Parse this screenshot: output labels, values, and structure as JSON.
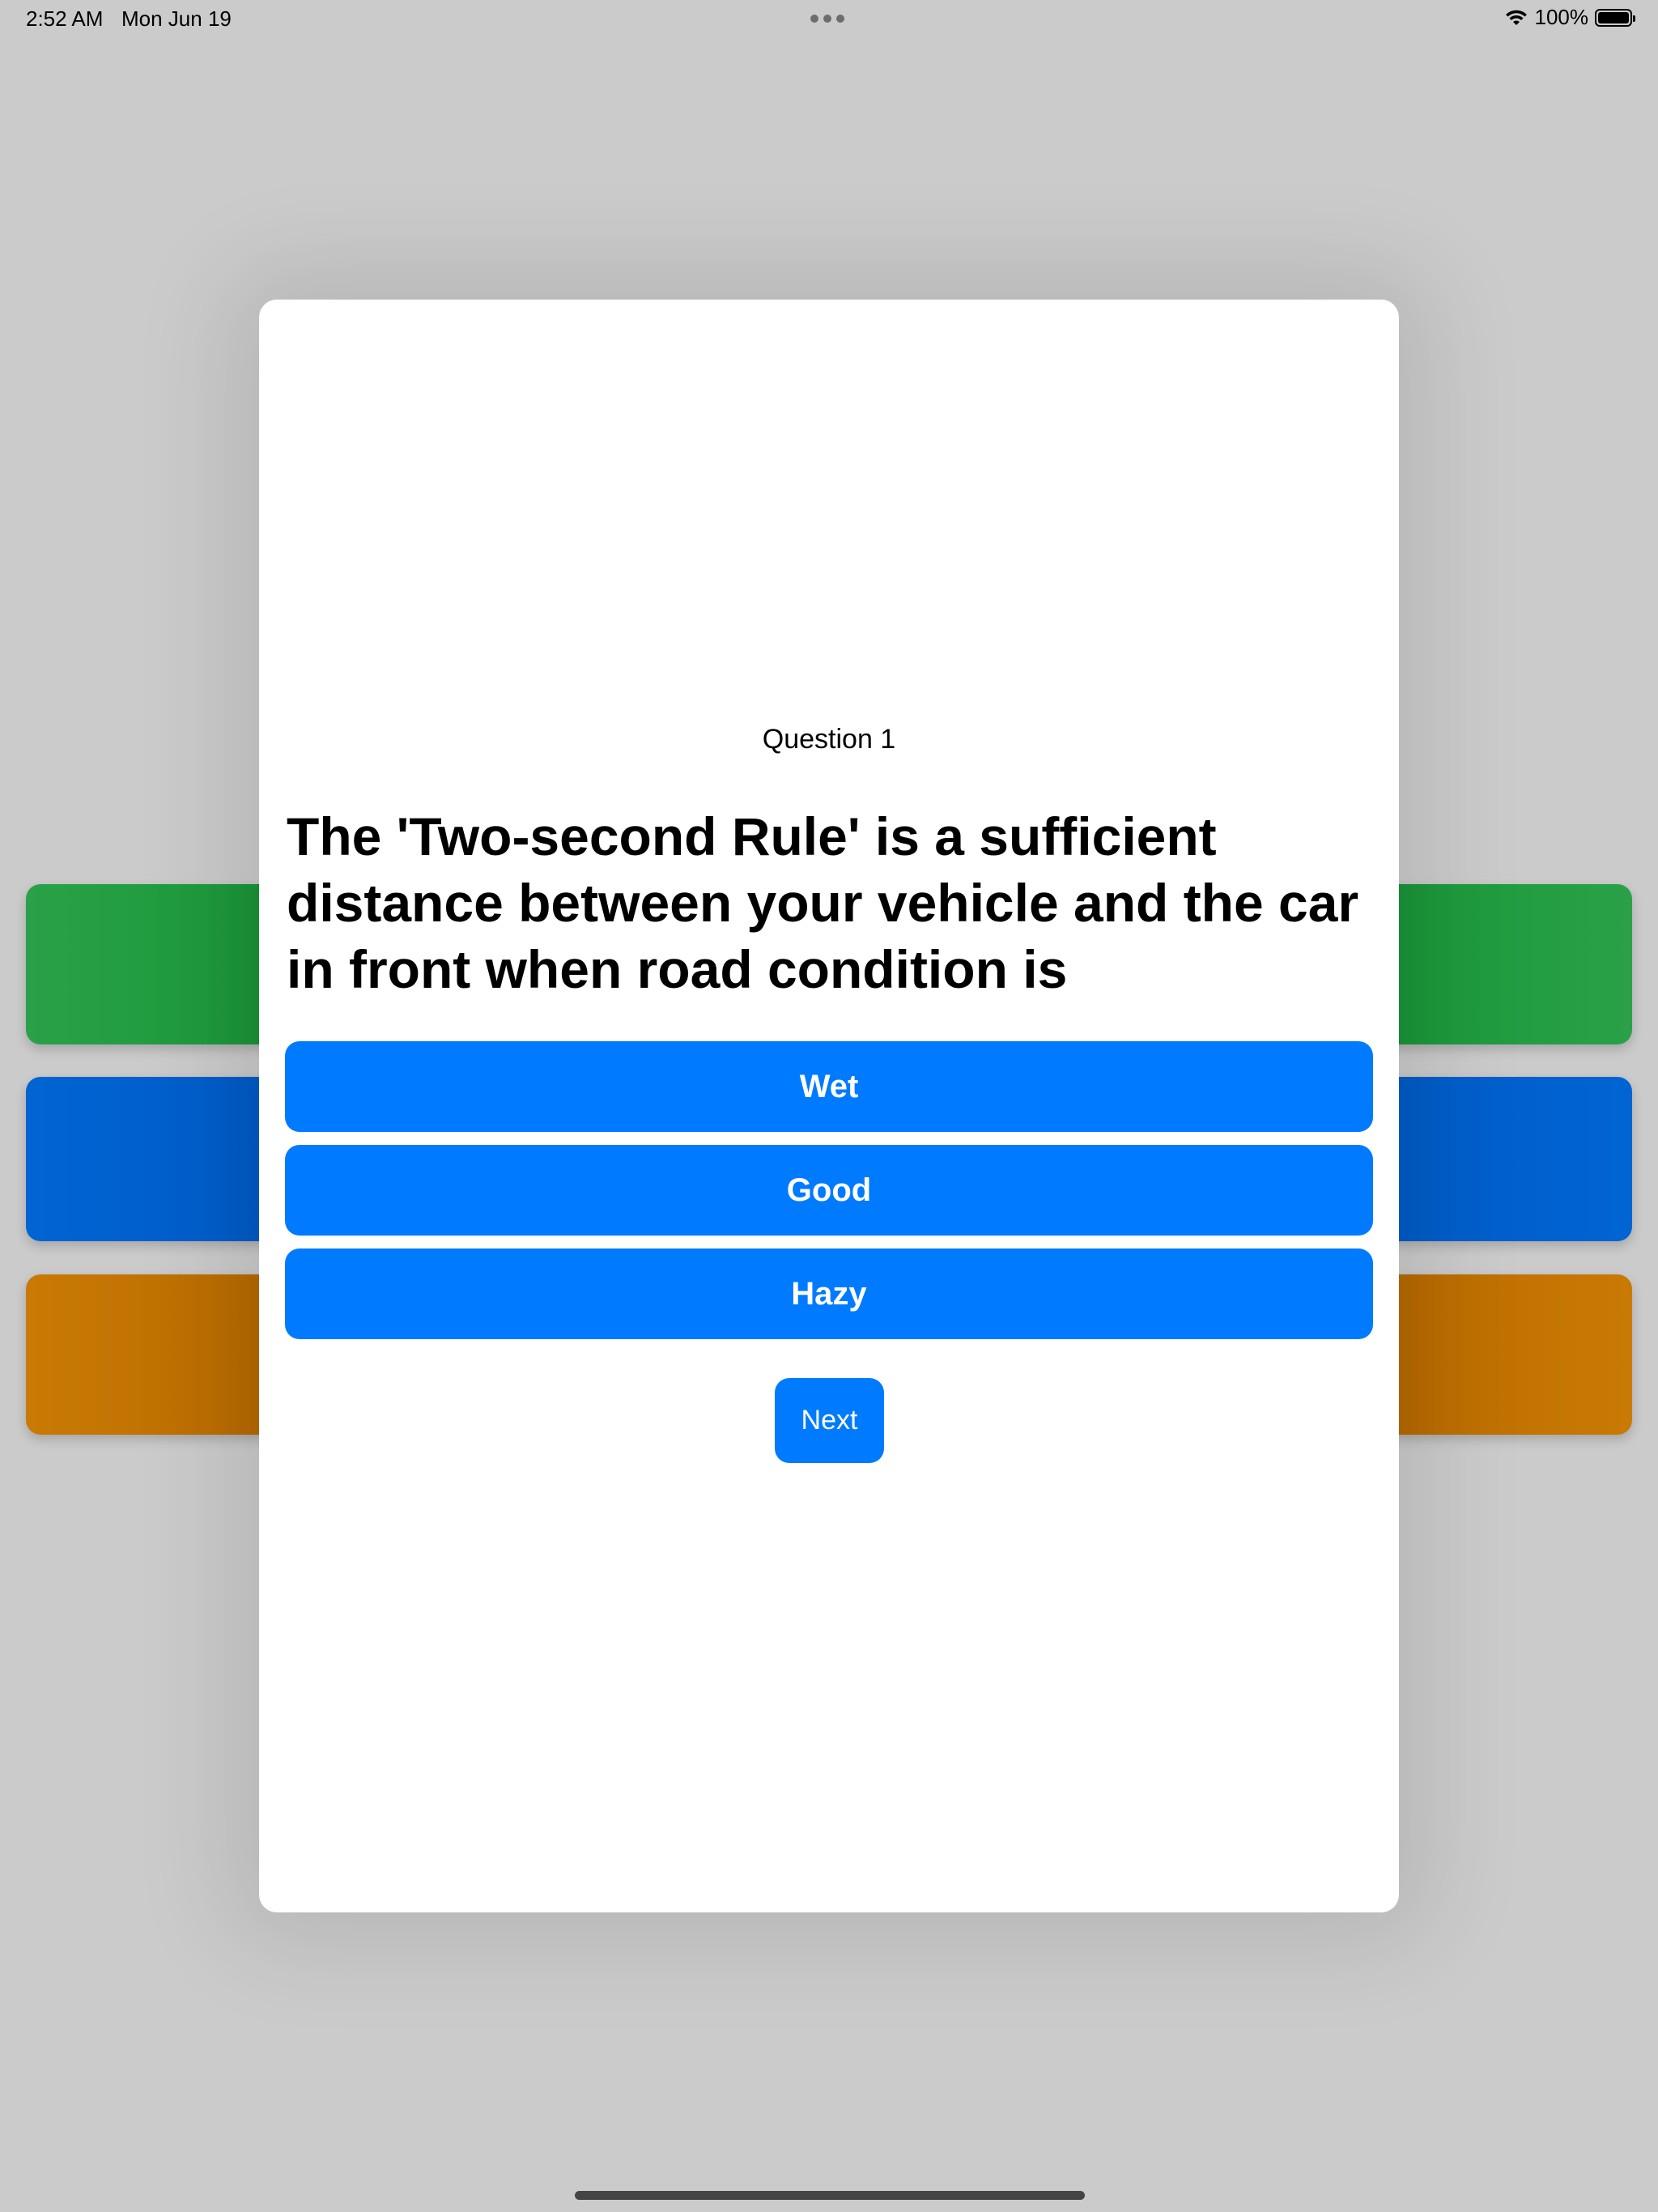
{
  "status_bar": {
    "time": "2:52 AM",
    "date": "Mon Jun 19",
    "battery_percent": "100%",
    "battery_level": 1.0,
    "icons": [
      "wifi-icon",
      "battery-icon",
      "multitasking-dots-icon"
    ]
  },
  "colors": {
    "background": "#cbcbcb",
    "card": "#ffffff",
    "accent_blue": "#007aff",
    "bar_green": "#1e9a3c",
    "bar_blue": "#005ecb",
    "bar_orange": "#bd6e00"
  },
  "quiz": {
    "question_number": "Question 1",
    "question_text": "The 'Two-second Rule' is a sufficient distance between your vehicle and the car in front when road condition is",
    "answers": [
      {
        "label": "Wet"
      },
      {
        "label": "Good"
      },
      {
        "label": "Hazy"
      }
    ],
    "next_label": "Next"
  }
}
